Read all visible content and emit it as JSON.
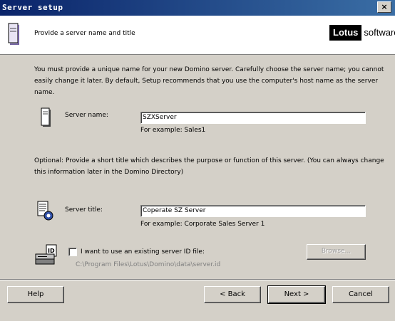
{
  "window": {
    "title": "Server setup",
    "close_label": "×"
  },
  "header": {
    "subtitle": "Provide a server name and title",
    "logo_brand": "Lotus",
    "logo_suffix": "software"
  },
  "intro": {
    "line1": "You must provide a unique name for your new Domino server. Carefully choose the server name; you cannot",
    "line2": "easily change it later. By default, Setup recommends that you use the computer's host name as the server",
    "line3": "name."
  },
  "server_name": {
    "label": "Server name:",
    "value": "SZXServer",
    "hint": "For example: Sales1"
  },
  "optional": {
    "line1": "Optional: Provide a short title which describes the purpose or function of this server. (You can always change",
    "line2": "this information later in the Domino Directory)"
  },
  "server_title": {
    "label": "Server title:",
    "value": "Coperate SZ Server",
    "hint": "For example: Corporate Sales Server 1"
  },
  "id_file": {
    "checkbox_label": "I want to use an existing server ID file:",
    "checked": false,
    "path": "C:\\Program Files\\Lotus\\Domino\\data\\server.id",
    "browse_label": "Browse...",
    "icon_text": "ID"
  },
  "buttons": {
    "help": "Help",
    "back": "< Back",
    "next": "Next >",
    "cancel": "Cancel"
  }
}
